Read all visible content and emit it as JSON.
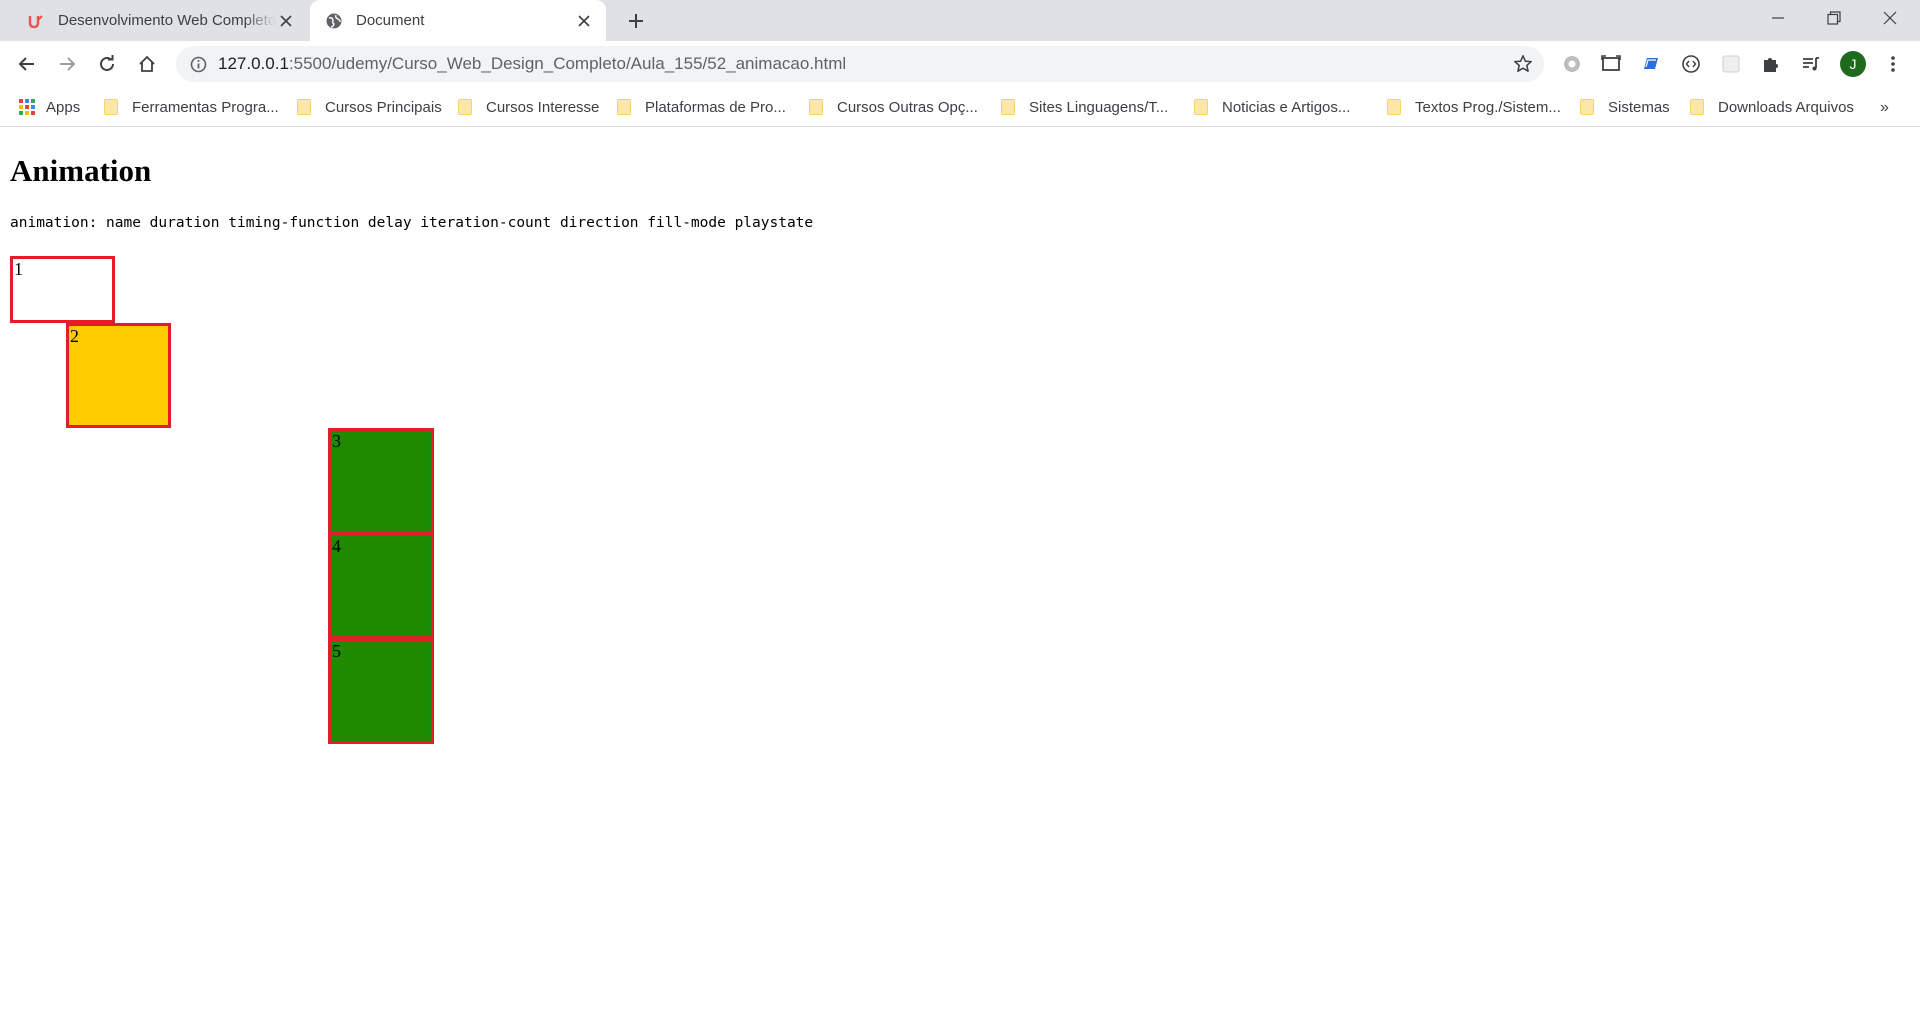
{
  "browser": {
    "tabs": [
      {
        "title": "Desenvolvimento Web Completo",
        "favicon": "udemy-icon",
        "active": false
      },
      {
        "title": "Document",
        "favicon": "globe-icon",
        "active": true
      }
    ],
    "address": {
      "host": "127.0.0.1",
      "path": ":5500/udemy/Curso_Web_Design_Completo/Aula_155/52_animacao.html"
    },
    "avatar_initial": "J",
    "bookmarks": [
      "Apps",
      "Ferramentas Progra...",
      "Cursos Principais",
      "Cursos Interesse",
      "Plataformas de Pro...",
      "Cursos Outras Opç...",
      "Sites Linguagens/T...",
      "Noticias e Artigos...",
      "Textos Prog./Sistem...",
      "Sistemas",
      "Downloads Arquivos"
    ],
    "bookmarks_more": "»"
  },
  "page": {
    "heading": "Animation",
    "syntax": "animation: name duration timing-function delay iteration-count direction fill-mode playstate",
    "boxes": [
      {
        "label": "1",
        "fill": "#ffffff"
      },
      {
        "label": "2",
        "fill": "#ffcc00"
      },
      {
        "label": "3",
        "fill": "#1f8a00"
      },
      {
        "label": "4",
        "fill": "#1f8a00"
      },
      {
        "label": "5",
        "fill": "#1f8a00"
      }
    ]
  },
  "colors": {
    "box_border": "#e01f2a",
    "chrome_bg": "#dee1e6",
    "omnibox_bg": "#f1f3f4"
  }
}
